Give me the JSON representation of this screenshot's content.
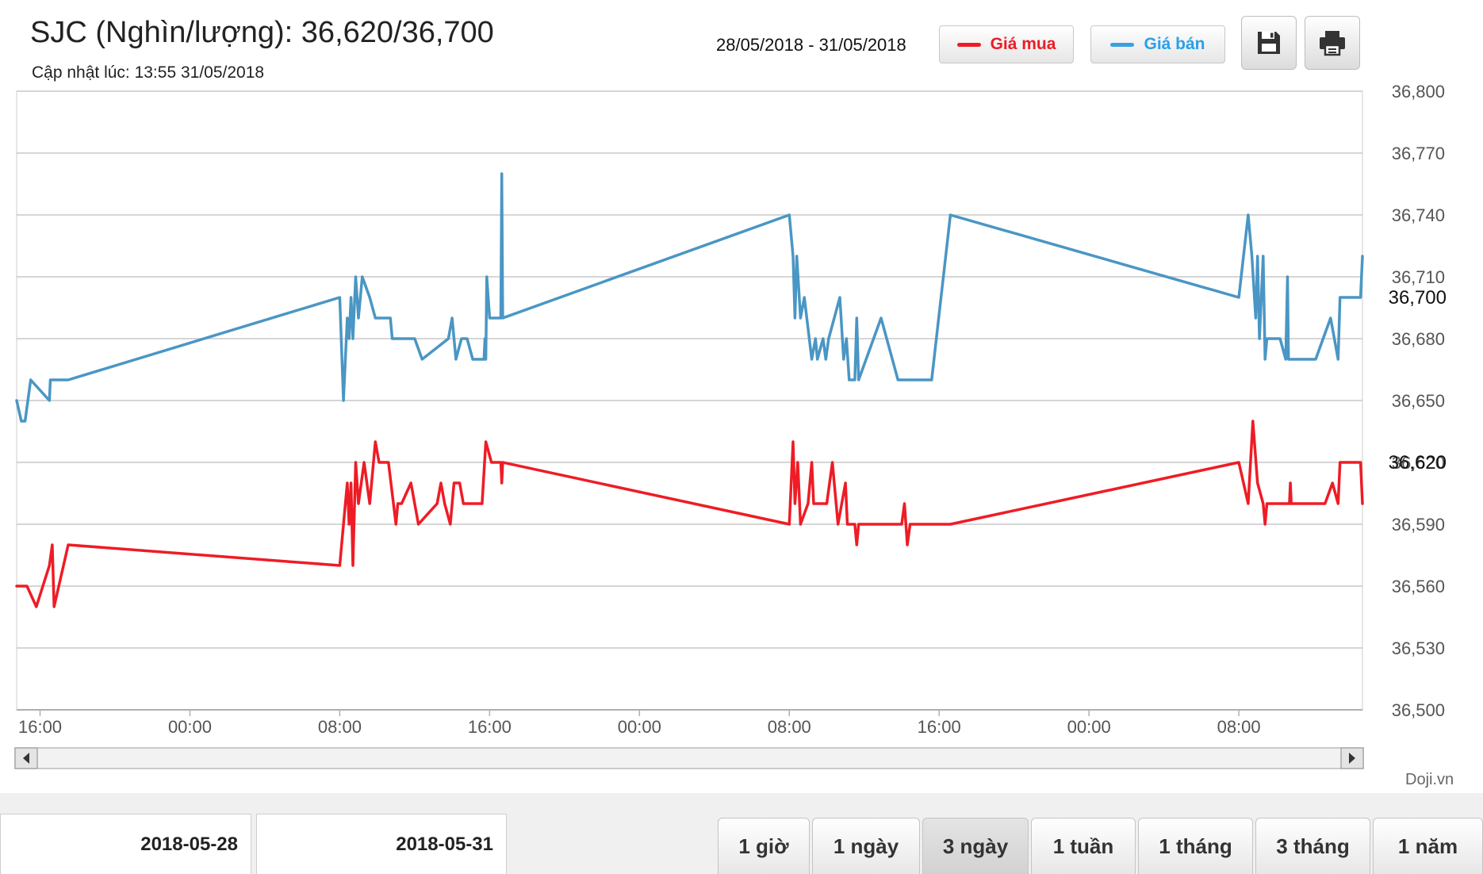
{
  "header": {
    "title": "SJC (Nghìn/lượng): 36,620/36,700",
    "updated": "Cập nhật lúc: 13:55 31/05/2018",
    "date_range": "28/05/2018 - 31/05/2018"
  },
  "legend": {
    "buy_label": "Giá mua",
    "sell_label": "Giá bán",
    "buy_color": "#ee1c25",
    "sell_color": "#4a96c4"
  },
  "toolbar": {
    "save_icon": "floppy-disk-icon",
    "print_icon": "printer-icon"
  },
  "brand": "Doji.vn",
  "navigator": {
    "start_date": "2018-05-28",
    "end_date": "2018-05-31"
  },
  "ranges": [
    {
      "label": "1 giờ",
      "active": false
    },
    {
      "label": "1 ngày",
      "active": false
    },
    {
      "label": "3 ngày",
      "active": true
    },
    {
      "label": "1 tuần",
      "active": false
    },
    {
      "label": "1 tháng",
      "active": false
    },
    {
      "label": "3 tháng",
      "active": false
    },
    {
      "label": "1 năm",
      "active": false
    }
  ],
  "chart_data": {
    "type": "line",
    "grid": true,
    "ylim": [
      36500,
      36800
    ],
    "y_ticks": [
      "36,500",
      "36,530",
      "36,560",
      "36,590",
      "36,620",
      "36,650",
      "36,680",
      "36,710",
      "36,740",
      "36,770",
      "36,800"
    ],
    "x_tick_labels": [
      "16:00",
      "00:00",
      "08:00",
      "16:00",
      "00:00",
      "08:00",
      "16:00",
      "00:00",
      "08:00"
    ],
    "x_tick_hours": [
      16,
      24,
      32,
      40,
      48,
      56,
      64,
      72,
      80
    ],
    "xlim_hours": [
      14.75,
      86.6
    ],
    "current": {
      "sell": "36,700",
      "buy": "36,620",
      "sell_value": 36700,
      "buy_value": 36620
    },
    "series": [
      {
        "name": "Giá bán",
        "color": "#4a96c4",
        "points": [
          [
            14.75,
            36650
          ],
          [
            15.0,
            36640
          ],
          [
            15.2,
            36640
          ],
          [
            15.5,
            36660
          ],
          [
            16.5,
            36650
          ],
          [
            16.55,
            36660
          ],
          [
            17.5,
            36660
          ],
          [
            32.0,
            36700
          ],
          [
            32.2,
            36650
          ],
          [
            32.4,
            36690
          ],
          [
            32.5,
            36680
          ],
          [
            32.6,
            36700
          ],
          [
            32.7,
            36680
          ],
          [
            32.85,
            36710
          ],
          [
            33.0,
            36690
          ],
          [
            33.2,
            36710
          ],
          [
            33.6,
            36700
          ],
          [
            33.9,
            36690
          ],
          [
            34.7,
            36690
          ],
          [
            34.8,
            36680
          ],
          [
            36.0,
            36680
          ],
          [
            36.4,
            36670
          ],
          [
            37.8,
            36680
          ],
          [
            38.0,
            36690
          ],
          [
            38.2,
            36670
          ],
          [
            38.5,
            36680
          ],
          [
            38.8,
            36680
          ],
          [
            39.1,
            36670
          ],
          [
            39.7,
            36670
          ],
          [
            39.75,
            36680
          ],
          [
            39.8,
            36670
          ],
          [
            39.85,
            36710
          ],
          [
            40.0,
            36690
          ],
          [
            40.6,
            36690
          ],
          [
            40.65,
            36760
          ],
          [
            40.7,
            36690
          ],
          [
            56.0,
            36740
          ],
          [
            56.2,
            36720
          ],
          [
            56.3,
            36690
          ],
          [
            56.4,
            36720
          ],
          [
            56.6,
            36690
          ],
          [
            56.8,
            36700
          ],
          [
            57.2,
            36670
          ],
          [
            57.4,
            36680
          ],
          [
            57.5,
            36670
          ],
          [
            57.8,
            36680
          ],
          [
            57.95,
            36670
          ],
          [
            58.1,
            36680
          ],
          [
            58.7,
            36700
          ],
          [
            58.9,
            36670
          ],
          [
            59.05,
            36680
          ],
          [
            59.2,
            36660
          ],
          [
            59.5,
            36660
          ],
          [
            59.6,
            36690
          ],
          [
            59.7,
            36660
          ],
          [
            60.9,
            36690
          ],
          [
            61.8,
            36660
          ],
          [
            63.6,
            36660
          ],
          [
            64.6,
            36740
          ],
          [
            80.0,
            36700
          ],
          [
            80.5,
            36740
          ],
          [
            80.7,
            36720
          ],
          [
            80.9,
            36690
          ],
          [
            81.0,
            36720
          ],
          [
            81.1,
            36680
          ],
          [
            81.3,
            36720
          ],
          [
            81.4,
            36670
          ],
          [
            81.5,
            36680
          ],
          [
            82.2,
            36680
          ],
          [
            82.5,
            36670
          ],
          [
            82.6,
            36710
          ],
          [
            82.65,
            36670
          ],
          [
            84.1,
            36670
          ],
          [
            84.9,
            36690
          ],
          [
            85.3,
            36670
          ],
          [
            85.4,
            36700
          ],
          [
            86.5,
            36700
          ],
          [
            86.6,
            36720
          ]
        ]
      },
      {
        "name": "Giá mua",
        "color": "#ee1c25",
        "points": [
          [
            14.75,
            36560
          ],
          [
            15.3,
            36560
          ],
          [
            15.8,
            36550
          ],
          [
            16.5,
            36570
          ],
          [
            16.65,
            36580
          ],
          [
            16.75,
            36550
          ],
          [
            17.5,
            36580
          ],
          [
            32.0,
            36570
          ],
          [
            32.3,
            36600
          ],
          [
            32.4,
            36610
          ],
          [
            32.5,
            36590
          ],
          [
            32.6,
            36610
          ],
          [
            32.7,
            36570
          ],
          [
            32.85,
            36620
          ],
          [
            33.0,
            36600
          ],
          [
            33.3,
            36620
          ],
          [
            33.6,
            36600
          ],
          [
            33.9,
            36630
          ],
          [
            34.1,
            36620
          ],
          [
            34.6,
            36620
          ],
          [
            35.0,
            36590
          ],
          [
            35.1,
            36600
          ],
          [
            35.3,
            36600
          ],
          [
            35.8,
            36610
          ],
          [
            36.2,
            36590
          ],
          [
            37.2,
            36600
          ],
          [
            37.4,
            36610
          ],
          [
            37.6,
            36600
          ],
          [
            37.9,
            36590
          ],
          [
            38.1,
            36610
          ],
          [
            38.4,
            36610
          ],
          [
            38.6,
            36600
          ],
          [
            39.6,
            36600
          ],
          [
            39.8,
            36630
          ],
          [
            40.1,
            36620
          ],
          [
            40.6,
            36620
          ],
          [
            40.65,
            36610
          ],
          [
            40.7,
            36620
          ],
          [
            56.0,
            36590
          ],
          [
            56.2,
            36630
          ],
          [
            56.3,
            36600
          ],
          [
            56.45,
            36620
          ],
          [
            56.6,
            36590
          ],
          [
            57.0,
            36600
          ],
          [
            57.2,
            36620
          ],
          [
            57.3,
            36600
          ],
          [
            58.0,
            36600
          ],
          [
            58.3,
            36620
          ],
          [
            58.6,
            36590
          ],
          [
            59.0,
            36610
          ],
          [
            59.1,
            36590
          ],
          [
            59.5,
            36590
          ],
          [
            59.6,
            36580
          ],
          [
            59.7,
            36590
          ],
          [
            62.0,
            36590
          ],
          [
            62.15,
            36600
          ],
          [
            62.3,
            36580
          ],
          [
            62.45,
            36590
          ],
          [
            64.6,
            36590
          ],
          [
            80.0,
            36620
          ],
          [
            80.5,
            36600
          ],
          [
            80.75,
            36640
          ],
          [
            81.0,
            36610
          ],
          [
            81.3,
            36600
          ],
          [
            81.4,
            36590
          ],
          [
            81.5,
            36600
          ],
          [
            82.7,
            36600
          ],
          [
            82.75,
            36610
          ],
          [
            82.8,
            36600
          ],
          [
            84.6,
            36600
          ],
          [
            85.0,
            36610
          ],
          [
            85.3,
            36600
          ],
          [
            85.4,
            36620
          ],
          [
            86.5,
            36620
          ],
          [
            86.6,
            36600
          ]
        ]
      }
    ]
  }
}
